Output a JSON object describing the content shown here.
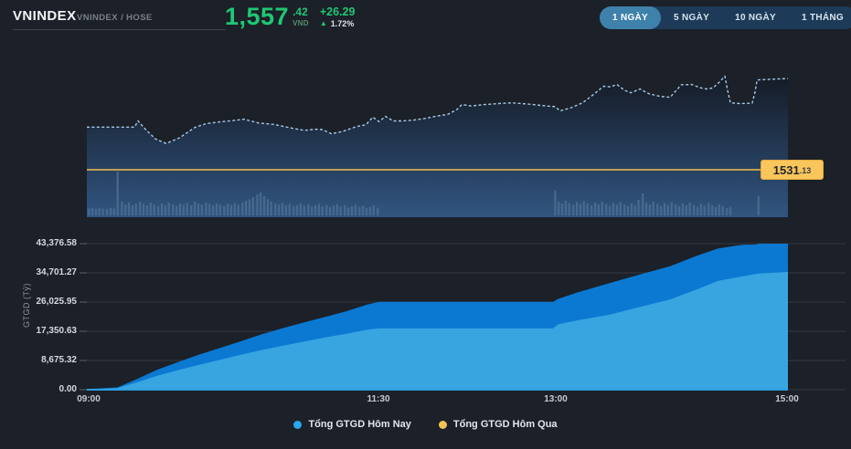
{
  "header": {
    "title": "VNINDEX",
    "subtitle": "VNINDEX / HOSE",
    "price": {
      "main": "1,557",
      "fraction": ".42",
      "currency": "VND",
      "change": "+26.29",
      "up_arrow": "▲",
      "change_pct": "1.72%"
    },
    "ranges": [
      {
        "label": "1 NGÀY",
        "active": true
      },
      {
        "label": "5 NGÀY",
        "active": false
      },
      {
        "label": "10 NGÀY",
        "active": false
      },
      {
        "label": "1 THÁNG",
        "active": false
      }
    ]
  },
  "colors": {
    "background": "#1c2028",
    "accent_green": "#1ec875",
    "accent_yellow": "#f2bf51",
    "selected_range": "#3e81aa",
    "range_container": "#1d3b59"
  },
  "chart_data": [
    {
      "type": "line",
      "name": "price-intraday",
      "symbol": "VNINDEX",
      "last_value": 1557.42,
      "prev_close": 1531.13,
      "prev_close_label_main": "1531",
      "prev_close_label_frac": ".13",
      "line_color": "#a7c9e8",
      "prev_close_color": "#f2bf51",
      "fill_gradient": [
        "#151b26",
        "#315580"
      ],
      "volume_color": "#4a6d92",
      "x_range": [
        "09:00",
        "15:00"
      ],
      "points": [
        [
          0.0,
          1543.4
        ],
        [
          0.068,
          1543.4
        ],
        [
          0.073,
          1545.2
        ],
        [
          0.085,
          1542.5
        ],
        [
          0.098,
          1540.0
        ],
        [
          0.113,
          1538.7
        ],
        [
          0.132,
          1540.3
        ],
        [
          0.154,
          1543.3
        ],
        [
          0.17,
          1544.4
        ],
        [
          0.189,
          1544.9
        ],
        [
          0.209,
          1545.3
        ],
        [
          0.224,
          1545.7
        ],
        [
          0.245,
          1544.6
        ],
        [
          0.267,
          1544.2
        ],
        [
          0.293,
          1543.1
        ],
        [
          0.31,
          1542.5
        ],
        [
          0.326,
          1542.8
        ],
        [
          0.336,
          1542.7
        ],
        [
          0.349,
          1541.5
        ],
        [
          0.365,
          1542.2
        ],
        [
          0.385,
          1543.6
        ],
        [
          0.398,
          1544.1
        ],
        [
          0.408,
          1546.3
        ],
        [
          0.417,
          1545.0
        ],
        [
          0.426,
          1546.5
        ],
        [
          0.437,
          1545.2
        ],
        [
          0.45,
          1545.2
        ],
        [
          0.465,
          1545.4
        ],
        [
          0.482,
          1545.9
        ],
        [
          0.499,
          1546.6
        ],
        [
          0.515,
          1547.1
        ],
        [
          0.528,
          1548.5
        ],
        [
          0.535,
          1549.9
        ],
        [
          0.548,
          1549.5
        ],
        [
          0.567,
          1549.9
        ],
        [
          0.587,
          1550.2
        ],
        [
          0.606,
          1550.4
        ],
        [
          0.632,
          1550.0
        ],
        [
          0.652,
          1549.6
        ],
        [
          0.668,
          1549.3
        ],
        [
          0.675,
          1548.1
        ],
        [
          0.691,
          1549.0
        ],
        [
          0.707,
          1550.4
        ],
        [
          0.724,
          1553.0
        ],
        [
          0.737,
          1555.2
        ],
        [
          0.747,
          1555.0
        ],
        [
          0.756,
          1555.7
        ],
        [
          0.767,
          1554.0
        ],
        [
          0.776,
          1553.3
        ],
        [
          0.789,
          1554.4
        ],
        [
          0.802,
          1553.0
        ],
        [
          0.817,
          1552.3
        ],
        [
          0.832,
          1552.0
        ],
        [
          0.848,
          1555.6
        ],
        [
          0.863,
          1555.7
        ],
        [
          0.874,
          1554.8
        ],
        [
          0.884,
          1554.4
        ],
        [
          0.893,
          1554.7
        ],
        [
          0.903,
          1556.5
        ],
        [
          0.91,
          1558.1
        ],
        [
          0.914,
          1554.0
        ],
        [
          0.918,
          1550.4
        ],
        [
          0.932,
          1550.2
        ],
        [
          0.949,
          1550.3
        ],
        [
          0.953,
          1553.5
        ],
        [
          0.956,
          1557.0
        ],
        [
          1.0,
          1557.4
        ]
      ],
      "volume_bars": [
        [
          0.003,
          0.15
        ],
        [
          0.008,
          0.16
        ],
        [
          0.013,
          0.14
        ],
        [
          0.018,
          0.16
        ],
        [
          0.023,
          0.15
        ],
        [
          0.029,
          0.14
        ],
        [
          0.034,
          0.16
        ],
        [
          0.039,
          0.15
        ],
        [
          0.044,
          0.96
        ],
        [
          0.05,
          0.3
        ],
        [
          0.055,
          0.24
        ],
        [
          0.06,
          0.28
        ],
        [
          0.065,
          0.22
        ],
        [
          0.07,
          0.26
        ],
        [
          0.076,
          0.3
        ],
        [
          0.081,
          0.25
        ],
        [
          0.086,
          0.22
        ],
        [
          0.091,
          0.28
        ],
        [
          0.096,
          0.24
        ],
        [
          0.102,
          0.2
        ],
        [
          0.107,
          0.26
        ],
        [
          0.112,
          0.22
        ],
        [
          0.117,
          0.28
        ],
        [
          0.123,
          0.24
        ],
        [
          0.128,
          0.21
        ],
        [
          0.133,
          0.26
        ],
        [
          0.138,
          0.23
        ],
        [
          0.143,
          0.27
        ],
        [
          0.149,
          0.22
        ],
        [
          0.154,
          0.3
        ],
        [
          0.159,
          0.26
        ],
        [
          0.164,
          0.24
        ],
        [
          0.17,
          0.28
        ],
        [
          0.175,
          0.25
        ],
        [
          0.18,
          0.22
        ],
        [
          0.185,
          0.26
        ],
        [
          0.19,
          0.24
        ],
        [
          0.196,
          0.21
        ],
        [
          0.201,
          0.25
        ],
        [
          0.206,
          0.23
        ],
        [
          0.211,
          0.27
        ],
        [
          0.216,
          0.24
        ],
        [
          0.222,
          0.28
        ],
        [
          0.227,
          0.32
        ],
        [
          0.232,
          0.35
        ],
        [
          0.237,
          0.4
        ],
        [
          0.243,
          0.46
        ],
        [
          0.248,
          0.5
        ],
        [
          0.253,
          0.42
        ],
        [
          0.258,
          0.36
        ],
        [
          0.263,
          0.3
        ],
        [
          0.269,
          0.26
        ],
        [
          0.274,
          0.24
        ],
        [
          0.279,
          0.27
        ],
        [
          0.284,
          0.22
        ],
        [
          0.289,
          0.25
        ],
        [
          0.295,
          0.2
        ],
        [
          0.3,
          0.23
        ],
        [
          0.305,
          0.26
        ],
        [
          0.31,
          0.21
        ],
        [
          0.316,
          0.24
        ],
        [
          0.321,
          0.19
        ],
        [
          0.326,
          0.22
        ],
        [
          0.331,
          0.25
        ],
        [
          0.336,
          0.2
        ],
        [
          0.342,
          0.23
        ],
        [
          0.347,
          0.18
        ],
        [
          0.352,
          0.21
        ],
        [
          0.357,
          0.24
        ],
        [
          0.362,
          0.19
        ],
        [
          0.368,
          0.22
        ],
        [
          0.373,
          0.17
        ],
        [
          0.378,
          0.2
        ],
        [
          0.383,
          0.23
        ],
        [
          0.389,
          0.18
        ],
        [
          0.394,
          0.21
        ],
        [
          0.399,
          0.16
        ],
        [
          0.404,
          0.19
        ],
        [
          0.409,
          0.22
        ],
        [
          0.415,
          0.17
        ],
        [
          0.668,
          0.55
        ],
        [
          0.673,
          0.3
        ],
        [
          0.678,
          0.26
        ],
        [
          0.683,
          0.32
        ],
        [
          0.688,
          0.27
        ],
        [
          0.694,
          0.23
        ],
        [
          0.699,
          0.29
        ],
        [
          0.704,
          0.25
        ],
        [
          0.709,
          0.31
        ],
        [
          0.714,
          0.26
        ],
        [
          0.72,
          0.22
        ],
        [
          0.725,
          0.28
        ],
        [
          0.73,
          0.24
        ],
        [
          0.735,
          0.3
        ],
        [
          0.741,
          0.25
        ],
        [
          0.746,
          0.21
        ],
        [
          0.751,
          0.27
        ],
        [
          0.756,
          0.23
        ],
        [
          0.761,
          0.29
        ],
        [
          0.767,
          0.24
        ],
        [
          0.772,
          0.2
        ],
        [
          0.777,
          0.26
        ],
        [
          0.782,
          0.22
        ],
        [
          0.787,
          0.34
        ],
        [
          0.793,
          0.48
        ],
        [
          0.798,
          0.28
        ],
        [
          0.803,
          0.24
        ],
        [
          0.808,
          0.3
        ],
        [
          0.814,
          0.25
        ],
        [
          0.819,
          0.21
        ],
        [
          0.824,
          0.27
        ],
        [
          0.829,
          0.23
        ],
        [
          0.834,
          0.29
        ],
        [
          0.84,
          0.24
        ],
        [
          0.845,
          0.2
        ],
        [
          0.85,
          0.26
        ],
        [
          0.855,
          0.22
        ],
        [
          0.86,
          0.28
        ],
        [
          0.866,
          0.23
        ],
        [
          0.871,
          0.19
        ],
        [
          0.876,
          0.25
        ],
        [
          0.881,
          0.21
        ],
        [
          0.887,
          0.27
        ],
        [
          0.892,
          0.22
        ],
        [
          0.897,
          0.18
        ],
        [
          0.902,
          0.24
        ],
        [
          0.907,
          0.2
        ],
        [
          0.913,
          0.16
        ],
        [
          0.918,
          0.18
        ],
        [
          0.958,
          0.42
        ]
      ]
    },
    {
      "type": "area",
      "name": "gtgd-cumulative",
      "axis_title": "GTGD (Tỷ)",
      "ylim": [
        0,
        43376.58
      ],
      "y_ticks": [
        "43,376.58",
        "34,701.27",
        "26,025.95",
        "17,350.63",
        "8,675.32",
        "0.00"
      ],
      "y_tick_values": [
        43376.58,
        34701.27,
        26025.95,
        17350.63,
        8675.32,
        0
      ],
      "x_ticks": [
        "09:00",
        "11:30",
        "13:00",
        "15:00"
      ],
      "grid": true,
      "legend_position": "bottom",
      "series": [
        {
          "name": "Tổng GTGD Hôm Nay",
          "area_color": "#0b79d2",
          "points": [
            [
              0.0,
              150
            ],
            [
              0.044,
              700
            ],
            [
              0.07,
              3000
            ],
            [
              0.1,
              5900
            ],
            [
              0.13,
              8200
            ],
            [
              0.16,
              10400
            ],
            [
              0.19,
              12400
            ],
            [
              0.22,
              14400
            ],
            [
              0.25,
              16500
            ],
            [
              0.28,
              18300
            ],
            [
              0.31,
              20000
            ],
            [
              0.34,
              21600
            ],
            [
              0.37,
              23300
            ],
            [
              0.4,
              25300
            ],
            [
              0.417,
              26100
            ],
            [
              0.665,
              26100
            ],
            [
              0.672,
              26950
            ],
            [
              0.7,
              28900
            ],
            [
              0.746,
              31700
            ],
            [
              0.789,
              34200
            ],
            [
              0.832,
              36670
            ],
            [
              0.87,
              39800
            ],
            [
              0.9,
              41900
            ],
            [
              0.92,
              42600
            ],
            [
              0.935,
              43050
            ],
            [
              0.955,
              43100
            ],
            [
              0.958,
              43376.58
            ],
            [
              1.0,
              43376.58
            ]
          ]
        },
        {
          "name": "Tổng GTGD Hôm Qua",
          "area_color": "#38a5e1",
          "points": [
            [
              0.0,
              100
            ],
            [
              0.044,
              450
            ],
            [
              0.07,
              2100
            ],
            [
              0.1,
              4100
            ],
            [
              0.13,
              5800
            ],
            [
              0.16,
              7400
            ],
            [
              0.19,
              8900
            ],
            [
              0.22,
              10400
            ],
            [
              0.25,
              11800
            ],
            [
              0.28,
              13100
            ],
            [
              0.31,
              14300
            ],
            [
              0.34,
              15500
            ],
            [
              0.37,
              16600
            ],
            [
              0.4,
              17800
            ],
            [
              0.417,
              18200
            ],
            [
              0.665,
              18200
            ],
            [
              0.672,
              19400
            ],
            [
              0.7,
              20600
            ],
            [
              0.746,
              22300
            ],
            [
              0.789,
              24600
            ],
            [
              0.832,
              26800
            ],
            [
              0.87,
              29800
            ],
            [
              0.9,
              32300
            ],
            [
              0.92,
              33100
            ],
            [
              0.958,
              34500
            ],
            [
              1.0,
              34960
            ]
          ]
        }
      ],
      "legend": [
        {
          "label": "Tổng GTGD Hôm Nay",
          "color": "#29a8eb"
        },
        {
          "label": "Tổng GTGD Hôm Qua",
          "color": "#f0c355"
        }
      ]
    }
  ]
}
